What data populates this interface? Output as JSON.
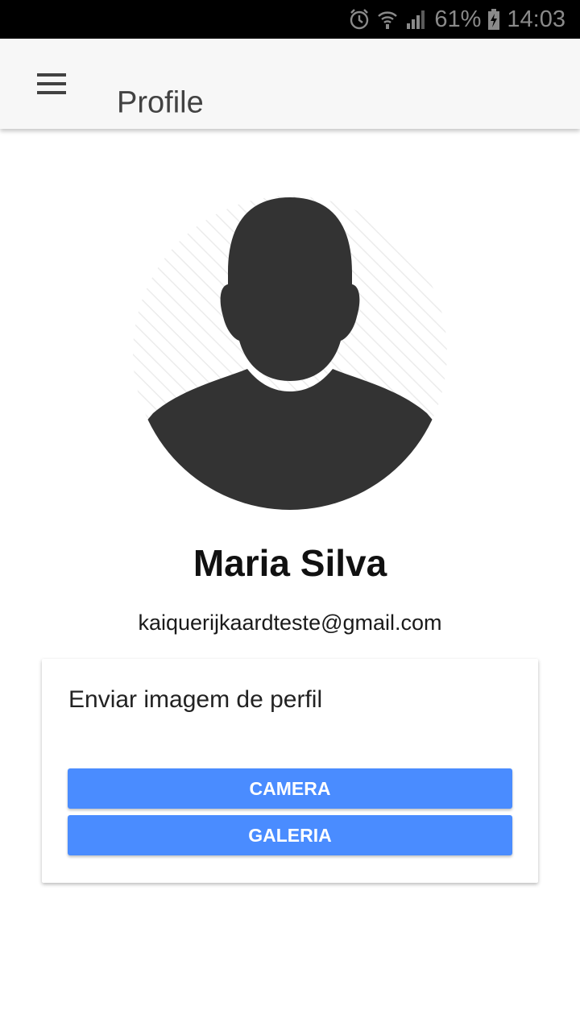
{
  "status_bar": {
    "battery": "61%",
    "time": "14:03",
    "icons": [
      "alarm-icon",
      "wifi-icon",
      "signal-icon",
      "battery-charging-icon"
    ]
  },
  "app_bar": {
    "title": "Profile",
    "menu_icon": "hamburger-menu-icon"
  },
  "profile": {
    "avatar_icon": "default-user-avatar-icon",
    "name": "Maria Silva",
    "email": "kaiquerijkaardteste@gmail.com"
  },
  "upload_card": {
    "title": "Enviar imagem de perfil",
    "camera_label": "CAMERA",
    "gallery_label": "GALERIA"
  },
  "colors": {
    "accent": "#4a8cff",
    "app_bar_bg": "#f7f7f7",
    "status_bar_bg": "#000000",
    "avatar_silhouette": "#333333"
  }
}
